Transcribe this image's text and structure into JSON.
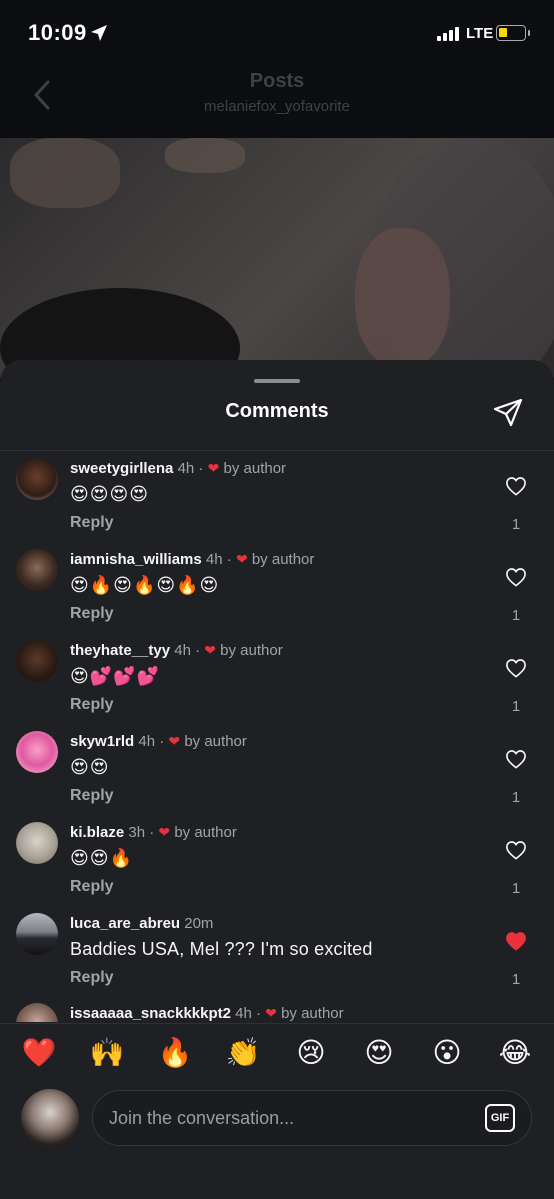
{
  "status_bar": {
    "time": "10:09",
    "network": "LTE",
    "battery_color": "#f5d90a"
  },
  "header": {
    "title": "Posts",
    "subtitle": "melaniefox_yofavorite"
  },
  "sheet": {
    "title": "Comments"
  },
  "comments": [
    {
      "username": "sweetygirllena",
      "time": "4h",
      "dot": "·",
      "by_author": "by author",
      "text": "😍😍😍😍",
      "reply": "Reply",
      "likes": "1",
      "liked": false
    },
    {
      "username": "iamnisha_williams",
      "time": "4h",
      "dot": "·",
      "by_author": "by author",
      "text": "😍🔥😍🔥😍🔥😍",
      "reply": "Reply",
      "likes": "1",
      "liked": false
    },
    {
      "username": "theyhate__tyy",
      "time": "4h",
      "dot": "·",
      "by_author": "by author",
      "text": "😍💕💕💕",
      "reply": "Reply",
      "likes": "1",
      "liked": false
    },
    {
      "username": "skyw1rld",
      "time": "4h",
      "dot": "·",
      "by_author": "by author",
      "text": "😍😍",
      "reply": "Reply",
      "likes": "1",
      "liked": false
    },
    {
      "username": "ki.blaze",
      "time": "3h",
      "dot": "·",
      "by_author": "by author",
      "text": "😍😍🔥",
      "reply": "Reply",
      "likes": "1",
      "liked": false
    },
    {
      "username": "luca_are_abreu",
      "time": "20m",
      "text": "Baddies USA, Mel ??? I'm so excited",
      "reply": "Reply",
      "likes": "1",
      "liked": true
    },
    {
      "username": "issaaaaa_snackkkkpt2",
      "time": "4h",
      "dot": "·",
      "by_author": "by author"
    }
  ],
  "emoji_bar": [
    "❤️",
    "🙌",
    "🔥",
    "👏",
    "😢",
    "😍",
    "😮",
    "😂"
  ],
  "input": {
    "placeholder": "Join the conversation...",
    "gif_label": "GIF"
  },
  "colors": {
    "accent_heart": "#e8323e",
    "sheet_bg": "#1f2024",
    "muted_text": "#a0a3a9"
  }
}
